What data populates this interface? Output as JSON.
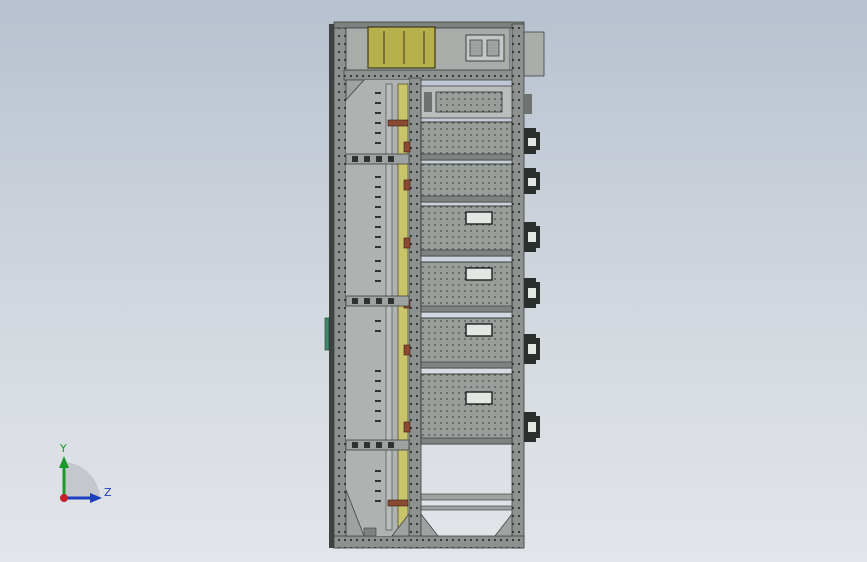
{
  "viewport": {
    "background_top": "#b7c1cf",
    "background_bottom": "#e2e5e9"
  },
  "model": {
    "subject": "electrical-switchgear-cabinet",
    "view": "side",
    "frame_color": "#8a8f8c",
    "frame_dark": "#3e4240",
    "panel_color": "#9a9e9b",
    "busbar_color": "#c9c36a",
    "top_box_color": "#b8b04a",
    "copper_color": "#8a4a32",
    "drawer_count": 7
  },
  "triad": {
    "y_label": "Y",
    "z_label": "Z",
    "x_color": "#c8202a",
    "y_color": "#1a9a2a",
    "z_color": "#1a3fbf"
  }
}
